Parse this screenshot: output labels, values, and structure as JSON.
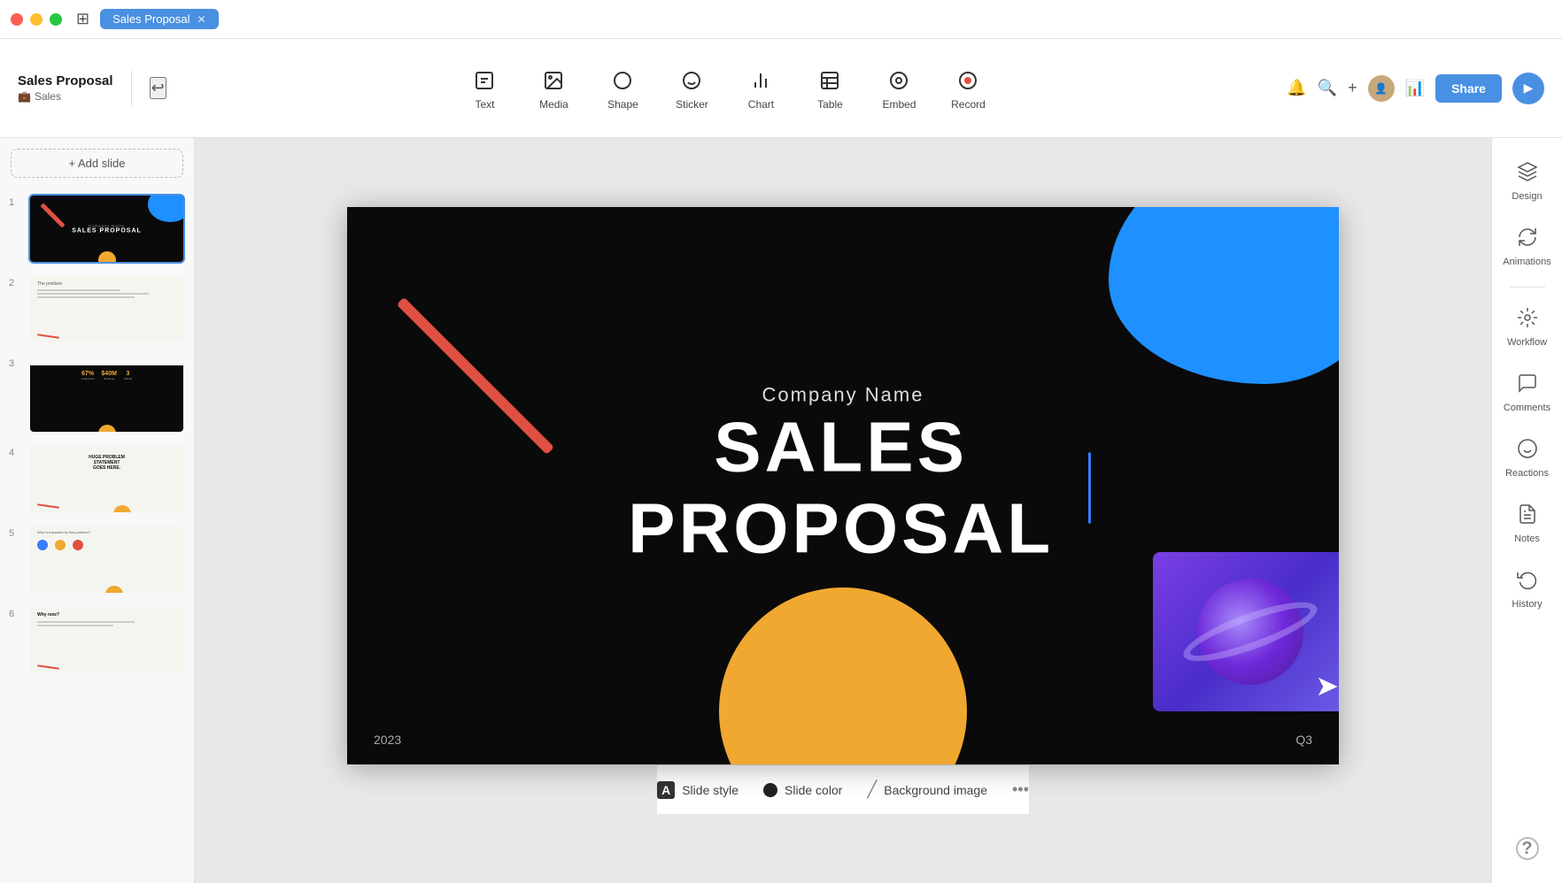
{
  "titlebar": {
    "tab_label": "Sales Proposal",
    "dots": [
      "red",
      "yellow",
      "green"
    ]
  },
  "toolbar": {
    "title": "Sales Proposal",
    "subtitle": "Sales",
    "subtitle_emoji": "💼",
    "undo_tooltip": "Undo",
    "tools": [
      {
        "id": "text",
        "label": "Text",
        "icon": "T"
      },
      {
        "id": "media",
        "label": "Media",
        "icon": "⊞"
      },
      {
        "id": "shape",
        "label": "Shape",
        "icon": "◻"
      },
      {
        "id": "sticker",
        "label": "Sticker",
        "icon": "☺"
      },
      {
        "id": "chart",
        "label": "Chart",
        "icon": "📊"
      },
      {
        "id": "table",
        "label": "Table",
        "icon": "⊞"
      },
      {
        "id": "embed",
        "label": "Embed",
        "icon": "⊙"
      },
      {
        "id": "record",
        "label": "Record",
        "icon": "⊙"
      }
    ],
    "share_label": "Share",
    "play_icon": "▶"
  },
  "add_slide_label": "+ Add slide",
  "slides": [
    {
      "number": "1",
      "label": "Slide 1 - Cover",
      "active": true
    },
    {
      "number": "2",
      "label": "Slide 2 - Problem"
    },
    {
      "number": "3",
      "label": "Slide 3 - Stats"
    },
    {
      "number": "4",
      "label": "Slide 4 - Problem Statement"
    },
    {
      "number": "5",
      "label": "Slide 5 - Who"
    },
    {
      "number": "6",
      "label": "Slide 6 - Why"
    }
  ],
  "canvas": {
    "company_name": "Company Name",
    "main_title": "SALES PROPOSAL",
    "year": "2023",
    "quarter": "Q3"
  },
  "right_panel": {
    "items": [
      {
        "id": "design",
        "label": "Design",
        "icon": "✦"
      },
      {
        "id": "animations",
        "label": "Animations",
        "icon": "⟳"
      },
      {
        "id": "workflow",
        "label": "Workflow",
        "icon": "⊕"
      },
      {
        "id": "comments",
        "label": "Comments",
        "icon": "💬"
      },
      {
        "id": "reactions",
        "label": "Reactions",
        "icon": "☺"
      },
      {
        "id": "notes",
        "label": "Notes",
        "icon": "📋"
      },
      {
        "id": "history",
        "label": "History",
        "icon": "⟲"
      }
    ],
    "help_icon": "?"
  },
  "bottom_bar": {
    "slide_style_label": "Slide style",
    "slide_color_label": "Slide color",
    "bg_image_label": "Background image",
    "more_icon": "•••"
  }
}
